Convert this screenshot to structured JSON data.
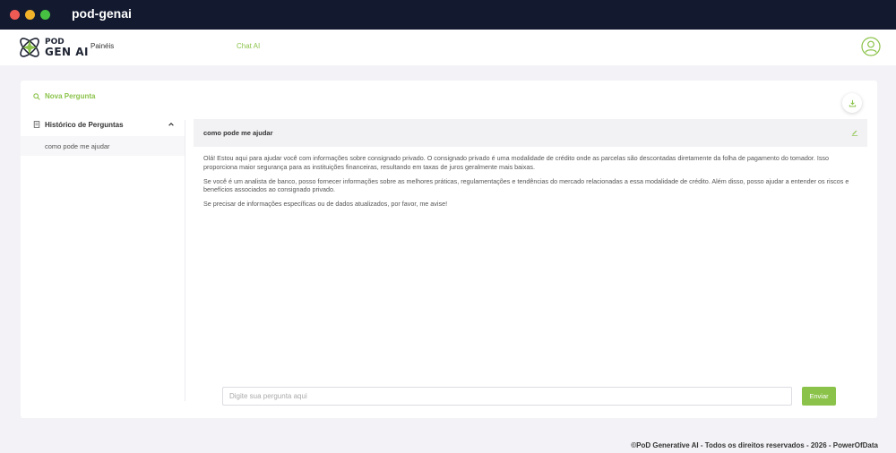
{
  "window": {
    "title": "pod-genai"
  },
  "logo": {
    "line1": "POD",
    "line2": "GEN AI"
  },
  "nav": {
    "paineis": "Painéis",
    "chat": "Chat AI"
  },
  "sidebar": {
    "new_question": "Nova Pergunta",
    "history_title": "Histórico de Perguntas",
    "items": [
      {
        "label": "como pode me ajudar"
      }
    ]
  },
  "chat": {
    "question": "como pode me ajudar",
    "answer": [
      "Olá! Estou aqui para ajudar você com informações sobre consignado privado. O consignado privado é uma modalidade de crédito onde as parcelas são descontadas diretamente da folha de pagamento do tomador. Isso proporciona maior segurança para as instituições financeiras, resultando em taxas de juros geralmente mais baixas.",
      "Se você é um analista de banco, posso fornecer informações sobre as melhores práticas, regulamentações e tendências do mercado relacionadas a essa modalidade de crédito. Além disso, posso ajudar a entender os riscos e benefícios associados ao consignado privado.",
      "Se precisar de informações específicas ou de dados atualizados, por favor, me avise!"
    ],
    "input_value": "",
    "input_placeholder": "Digite sua pergunta aqui",
    "send_label": "Enviar"
  },
  "footer": {
    "text": "©PoD Generative AI - Todos os direitos reservados - 2026 - PowerOfData"
  },
  "colors": {
    "accent": "#8bc34a",
    "titlebar": "#131a30",
    "background": "#f3f2f6"
  },
  "icons": {
    "new_question": "search-icon",
    "history": "document-icon",
    "collapse": "chevron-up-icon",
    "download": "download-icon",
    "edit": "pencil-icon",
    "user": "user-circle-icon"
  }
}
